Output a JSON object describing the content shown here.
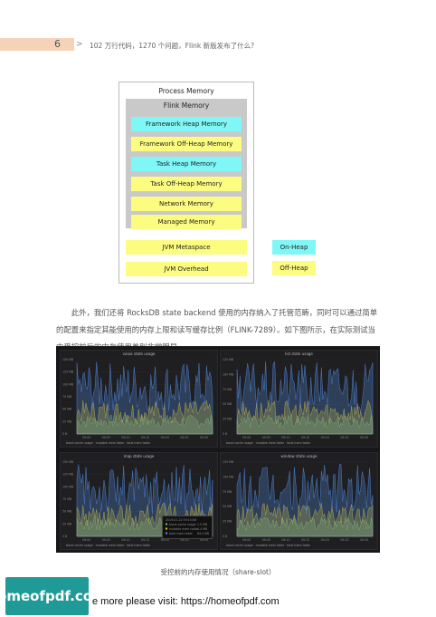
{
  "header": {
    "page_number": "6",
    "separator": ">",
    "title": "102 万行代码，1270 个问题，Flink 新版发布了什么?"
  },
  "diagram": {
    "title": "Process Memory",
    "flink_title": "Flink Memory",
    "blocks": [
      {
        "label": "Framework Heap Memory",
        "color": "#7ff7f7"
      },
      {
        "label": "Framework Off-Heap Memory",
        "color": "#fcfc80"
      },
      {
        "label": "Task Heap Memory",
        "color": "#7ff7f7"
      },
      {
        "label": "Task Off-Heap Memory",
        "color": "#fcfc80"
      },
      {
        "label": "Network Memory",
        "color": "#fcfc80"
      },
      {
        "label": "Managed Memory",
        "color": "#fcfc80"
      }
    ],
    "outside_blocks": [
      {
        "label": "JVM Metaspace",
        "color": "#fcfc80"
      },
      {
        "label": "JVM Overhead",
        "color": "#fcfc80"
      }
    ],
    "legend": [
      {
        "label": "On-Heap",
        "color": "#7ff7f7"
      },
      {
        "label": "Off-Heap",
        "color": "#fcfc80"
      }
    ]
  },
  "paragraph": "此外，我们还将 RocksDB state backend 使用的内存纳入了托管范畴，同时可以通过简单的配置来指定其能使用的内存上限和读写缓存比例（FLINK-7289）。如下图所示，在实际测试当中受控前后的内存使用差别非常明显。",
  "dashboard": {
    "panels": [
      {
        "title": "value state usage",
        "y_ticks": [
          "150 MB",
          "125 MB",
          "100 MB",
          "75 MB",
          "50 MB",
          "25 MB",
          "0 B"
        ]
      },
      {
        "title": "list state usage",
        "y_ticks": [
          "125 MB",
          "100 MB",
          "75 MB",
          "50 MB",
          "25 MB",
          "0 B"
        ]
      },
      {
        "title": "map state usage",
        "y_ticks": [
          "150 MB",
          "125 MB",
          "100 MB",
          "75 MB",
          "50 MB",
          "25 MB",
          "0 B"
        ]
      },
      {
        "title": "window state usage",
        "y_ticks": [
          "125 MB",
          "100 MB",
          "75 MB",
          "50 MB",
          "25 MB",
          "0 B"
        ]
      }
    ],
    "x_ticks": [
      "09:00",
      "09:05",
      "09:10",
      "09:15",
      "09:20",
      "09:25",
      "09:30"
    ],
    "legend": [
      "block cache usage",
      "mutable mem table",
      "total mem table"
    ],
    "tooltip": {
      "time": "2019-01-22 09:15:08",
      "rows": [
        {
          "label": "block cache usage",
          "value": "1.5 MB"
        },
        {
          "label": "mutable mem table",
          "value": "4.4 MB"
        },
        {
          "label": "total mem table",
          "value": "64.0 MB"
        }
      ]
    },
    "series_colors": [
      "#73bf69",
      "#f2cc0c",
      "#5794f2"
    ]
  },
  "caption": "受控前的内存使用情况（share-slot）",
  "footer": {
    "logo_text": "homeofpdf.com",
    "text": "e more please visit: https://homeofpdf.com"
  }
}
